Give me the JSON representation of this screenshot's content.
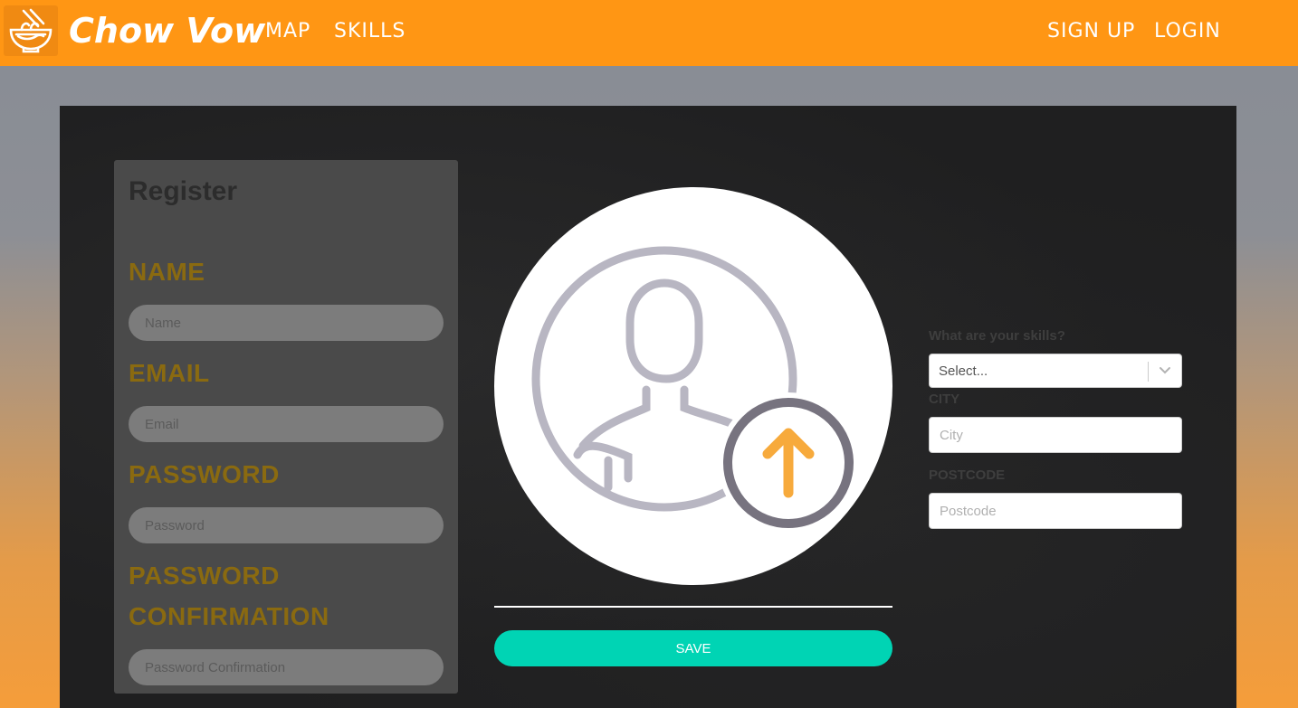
{
  "navbar": {
    "brand": "Chow Vow",
    "links": [
      "MAP",
      "SKILLS"
    ],
    "right_links": [
      "SIGN UP",
      "LOGIN"
    ],
    "color": "#ff9614"
  },
  "register": {
    "title": "Register",
    "fields": [
      {
        "label": "NAME",
        "placeholder": "Name"
      },
      {
        "label": "EMAIL",
        "placeholder": "Email"
      },
      {
        "label": "PASSWORD",
        "placeholder": "Password"
      },
      {
        "label": "PASSWORD CONFIRMATION",
        "placeholder": "Password Confirmation"
      }
    ]
  },
  "avatar": {
    "icon": "user-upload-icon"
  },
  "save_label": "SAVE",
  "skills": {
    "label": "What are your skills?",
    "select_value": "Select..."
  },
  "city": {
    "label": "CITY",
    "placeholder": "City"
  },
  "postcode": {
    "label": "POSTCODE",
    "placeholder": "Postcode"
  },
  "colors": {
    "accent": "#00d4b4",
    "label_gold": "#8a6a10",
    "upload_arrow": "#f7aa3c"
  }
}
